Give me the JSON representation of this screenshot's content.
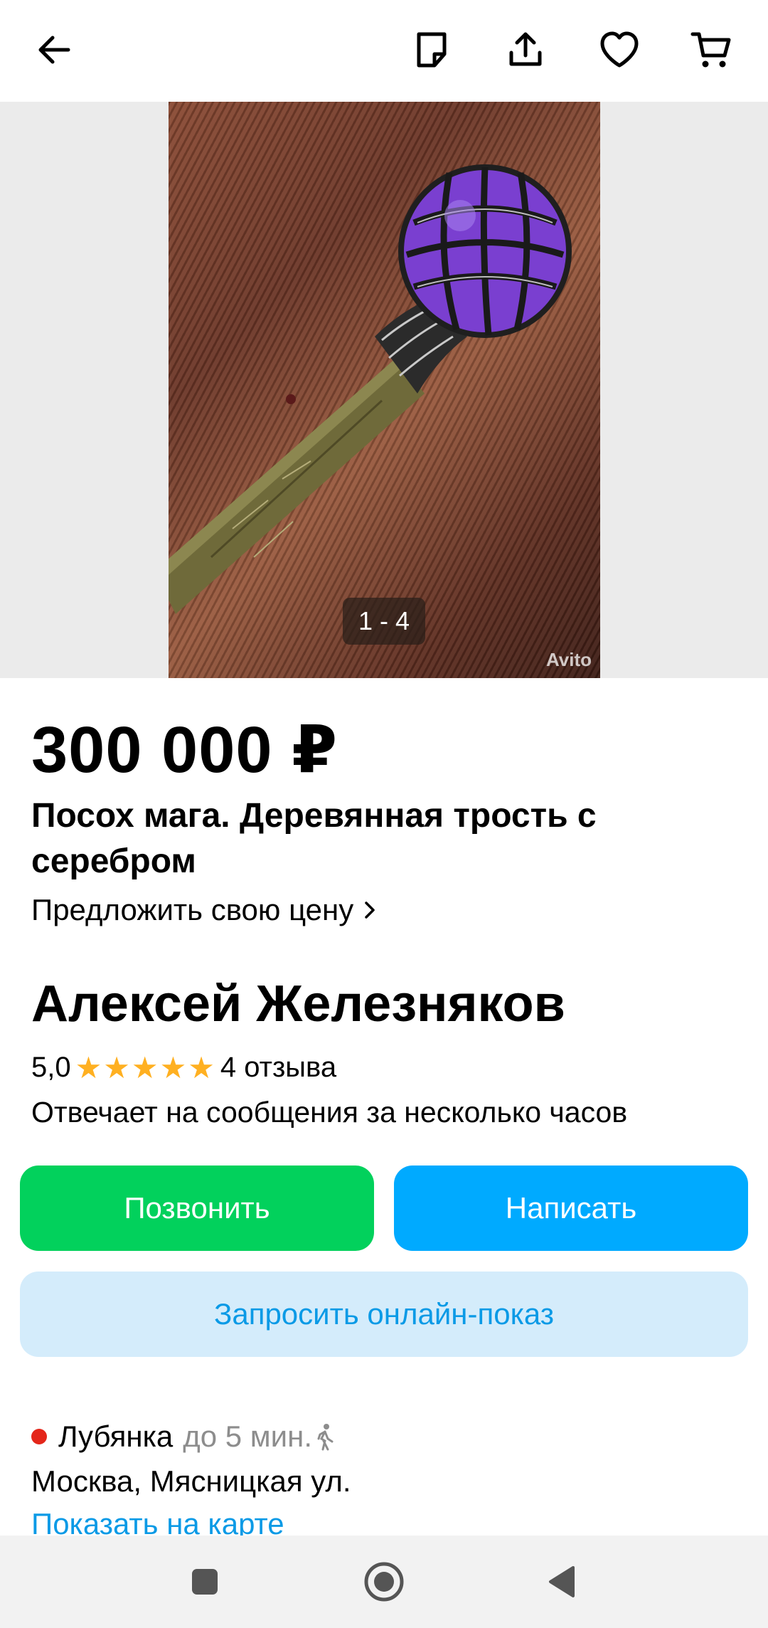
{
  "header": {
    "icons": [
      "back-arrow-icon",
      "note-icon",
      "share-icon",
      "heart-icon",
      "cart-icon"
    ]
  },
  "gallery": {
    "counter": "1 - 4",
    "watermark": "Avito"
  },
  "listing": {
    "price": "300 000 ₽",
    "title": "Посох мага. Деревянная трость с серебром",
    "offer_price_label": "Предложить свою цену"
  },
  "seller": {
    "name": "Алексей Железняков",
    "rating": "5,0",
    "stars": 5,
    "reviews": "4 отзыва",
    "response_time": "Отвечает на сообщения за несколько часов"
  },
  "actions": {
    "call": "Позвонить",
    "write": "Написать",
    "online_show": "Запросить онлайн-показ"
  },
  "location": {
    "metro": "Лубянка",
    "metro_time": "до 5 мин.",
    "metro_color": "#e4261a",
    "address": "Москва, Мясницкая ул.",
    "map_link": "Показать на карте"
  },
  "colors": {
    "call": "#02d15c",
    "write": "#00aaff",
    "online_show_bg": "#d4ecfb",
    "link": "#0a9ae6",
    "star": "#ffb021"
  }
}
